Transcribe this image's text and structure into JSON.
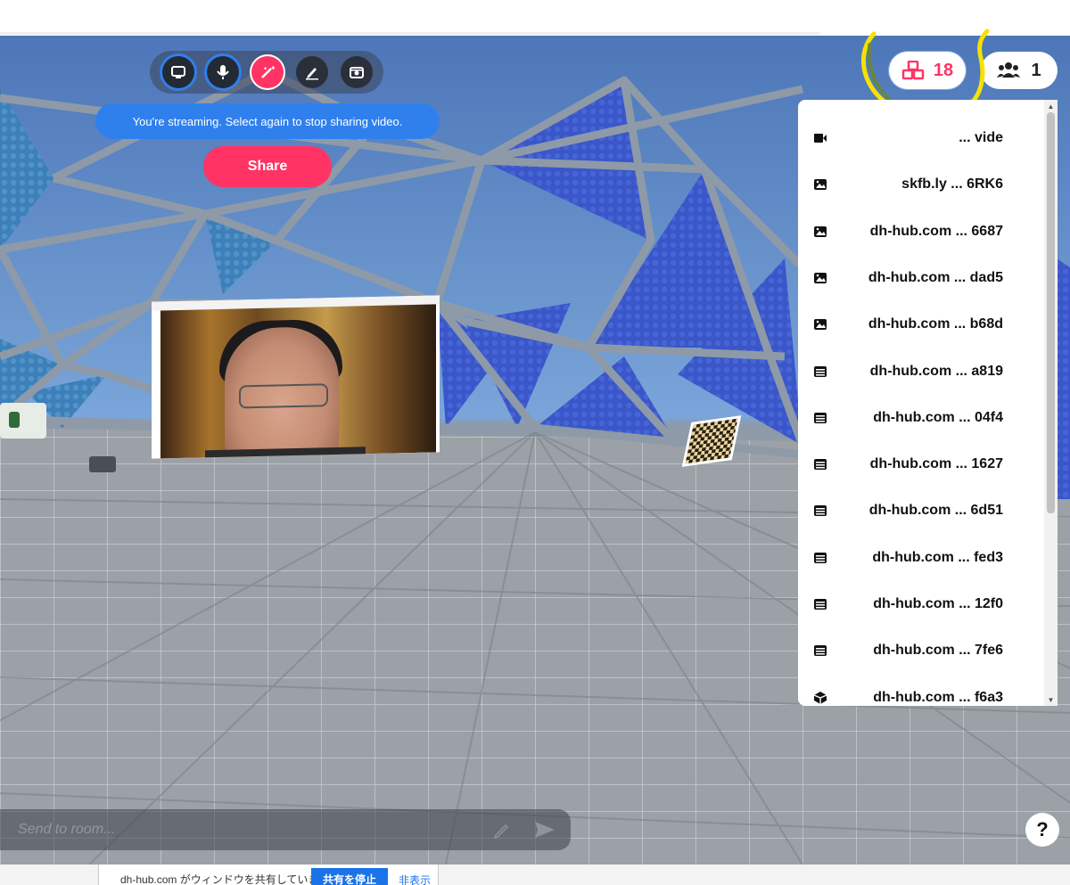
{
  "toolbar": {
    "buttons": [
      {
        "icon": "screen-share-icon",
        "state": "active"
      },
      {
        "icon": "microphone-icon",
        "state": "active"
      },
      {
        "icon": "magic-wand-icon",
        "state": "highlighted"
      },
      {
        "icon": "pen-icon",
        "state": "default"
      },
      {
        "icon": "camera-icon",
        "state": "default"
      }
    ]
  },
  "stream_message": "You're streaming. Select again to stop sharing video.",
  "share_button": "Share",
  "objects_count": "18",
  "people_count": "1",
  "objects": [
    {
      "icon": "video-icon",
      "name": "... vide"
    },
    {
      "icon": "image-icon",
      "name": "skfb.ly ... 6RK6"
    },
    {
      "icon": "image-icon",
      "name": "dh-hub.com ... 6687"
    },
    {
      "icon": "image-icon",
      "name": "dh-hub.com ... dad5"
    },
    {
      "icon": "image-icon",
      "name": "dh-hub.com ... b68d"
    },
    {
      "icon": "document-icon",
      "name": "dh-hub.com ... a819"
    },
    {
      "icon": "document-icon",
      "name": "dh-hub.com ... 04f4"
    },
    {
      "icon": "document-icon",
      "name": "dh-hub.com ... 1627"
    },
    {
      "icon": "document-icon",
      "name": "dh-hub.com ... 6d51"
    },
    {
      "icon": "document-icon",
      "name": "dh-hub.com ... fed3"
    },
    {
      "icon": "document-icon",
      "name": "dh-hub.com ... 12f0"
    },
    {
      "icon": "document-icon",
      "name": "dh-hub.com ... 7fe6"
    },
    {
      "icon": "model-icon",
      "name": "dh-hub.com ... f6a3"
    }
  ],
  "chat": {
    "placeholder": "Send to room..."
  },
  "help_label": "?",
  "taskbar": {
    "share_text": "dh-hub.com がウィンドウを共有しています",
    "stop_label": "共有を停止",
    "hide_label": "非表示"
  },
  "colors": {
    "accent": "#ff3464",
    "primary": "#2f80ed"
  }
}
